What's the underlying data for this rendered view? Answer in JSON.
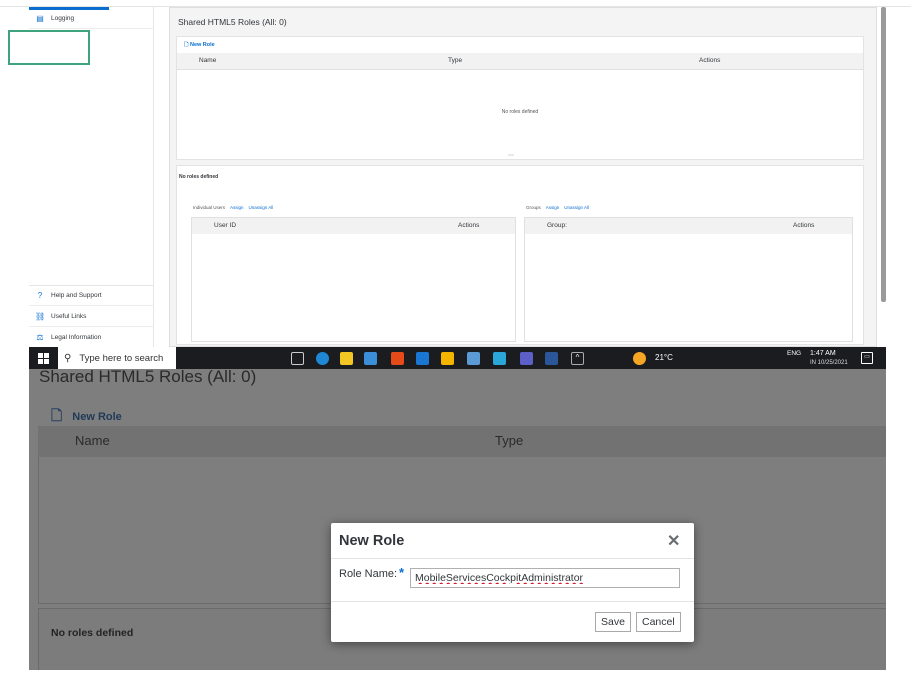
{
  "sidebar": {
    "top_item": {
      "label": "Logging",
      "icon": "log-icon"
    },
    "bottom_items": [
      {
        "label": "Help and Support",
        "icon": "help-icon"
      },
      {
        "label": "Useful Links",
        "icon": "link-icon"
      },
      {
        "label": "Legal Information",
        "icon": "scale-icon"
      }
    ]
  },
  "content": {
    "title": "Shared HTML5 Roles (All: 0)",
    "new_role_label": "New Role",
    "columns": {
      "name": "Name",
      "type": "Type",
      "actions": "Actions"
    },
    "empty_text": "No roles defined",
    "lower_title": "No roles defined",
    "users": {
      "label": "Individual Users",
      "assign": "Assign",
      "unassign_all": "Unassign All",
      "col_user": "User ID",
      "col_actions": "Actions"
    },
    "groups": {
      "label": "Groups",
      "assign": "Assign",
      "unassign_all": "Unassign All",
      "col_group": "Group:",
      "col_actions": "Actions"
    }
  },
  "taskbar": {
    "search_placeholder": "Type here to search",
    "temperature": "21°C",
    "language": "ENG",
    "time": "1:47 AM",
    "date": "IN 10/25/2021"
  },
  "zoom": {
    "title": "Shared HTML5 Roles (All: 0)",
    "new_role_label": "New Role",
    "col_name": "Name",
    "col_type": "Type",
    "no_roles": "No roles defined"
  },
  "dialog": {
    "title": "New Role",
    "role_name_label": "Role Name:",
    "required_marker": "*",
    "role_name_value": "MobileServicesCockpitAdministrator",
    "save_label": "Save",
    "cancel_label": "Cancel"
  },
  "colors": {
    "accent": "#0a6ed1",
    "highlight": "#3fa47e",
    "overlay": "#7e7e7e"
  }
}
